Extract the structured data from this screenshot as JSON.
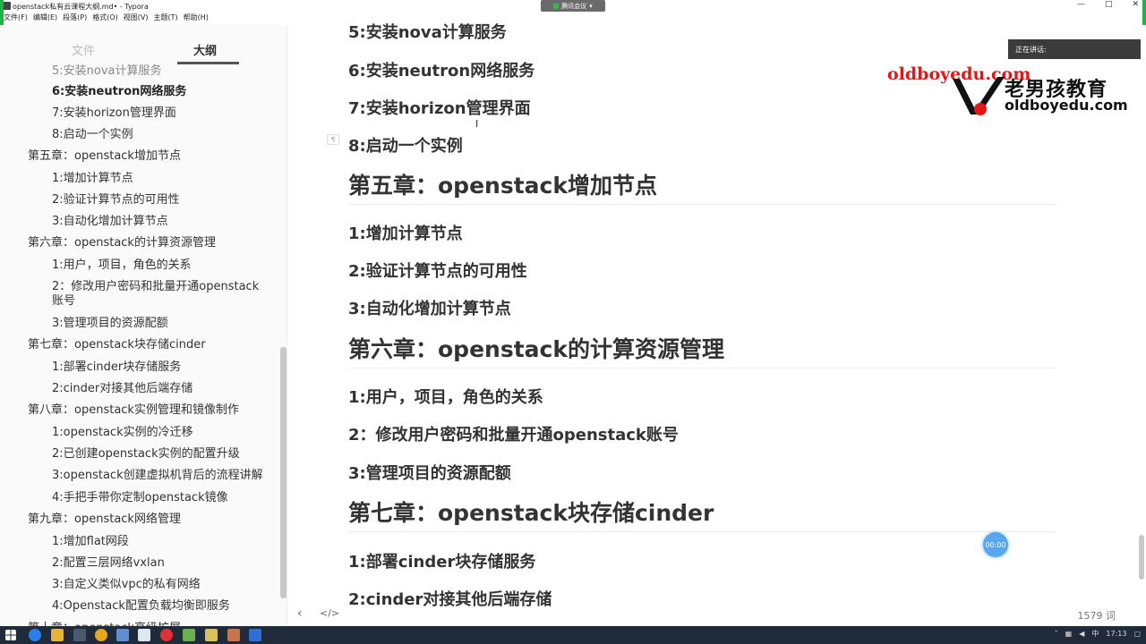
{
  "window": {
    "title": "openstack私有云课程大纲.md• - Typora",
    "min": "—",
    "max": "□",
    "close": "✕"
  },
  "meeting": {
    "label": "腾讯会议"
  },
  "menu": [
    "文件(F)",
    "编辑(E)",
    "段落(P)",
    "格式(O)",
    "视图(V)",
    "主题(T)",
    "帮助(H)"
  ],
  "sidebar": {
    "tab_files": "文件",
    "tab_outline": "大纲",
    "outline": [
      {
        "text": "5:安装nova计算服务",
        "level": 2
      },
      {
        "text": "6:安装neutron网络服务",
        "level": 2,
        "current": true
      },
      {
        "text": "7:安装horizon管理界面",
        "level": 2
      },
      {
        "text": "8:启动一个实例",
        "level": 2
      },
      {
        "text": "第五章：openstack增加节点",
        "level": 1
      },
      {
        "text": "1:增加计算节点",
        "level": 2
      },
      {
        "text": "2:验证计算节点的可用性",
        "level": 2
      },
      {
        "text": "3:自动化增加计算节点",
        "level": 2
      },
      {
        "text": "第六章：openstack的计算资源管理",
        "level": 1
      },
      {
        "text": "1:用户，项目，角色的关系",
        "level": 2
      },
      {
        "text": "2：修改用户密码和批量开通openstack账号",
        "level": 2,
        "wrap": true
      },
      {
        "text": "3:管理项目的资源配额",
        "level": 2
      },
      {
        "text": "第七章：openstack块存储cinder",
        "level": 1
      },
      {
        "text": "1:部署cinder块存储服务",
        "level": 2
      },
      {
        "text": "2:cinder对接其他后端存储",
        "level": 2
      },
      {
        "text": "第八章：openstack实例管理和镜像制作",
        "level": 1
      },
      {
        "text": "1:openstack实例的冷迁移",
        "level": 2
      },
      {
        "text": "2:已创建openstack实例的配置升级",
        "level": 2
      },
      {
        "text": "3:openstack创建虚拟机背后的流程讲解",
        "level": 2
      },
      {
        "text": "4:手把手带你定制openstack镜像",
        "level": 2
      },
      {
        "text": "第九章：openstack网络管理",
        "level": 1
      },
      {
        "text": "1:增加flat网段",
        "level": 2
      },
      {
        "text": "2:配置三层网络vxlan",
        "level": 2
      },
      {
        "text": "3:自定义类似vpc的私有网络",
        "level": 2
      },
      {
        "text": "4:Openstack配置负载均衡即服务",
        "level": 2
      },
      {
        "text": "第十章：openstack高级扩展",
        "level": 1
      }
    ]
  },
  "document": {
    "h_nova": "5:安装nova计算服务",
    "h_neutron": "6:安装neutron网络服务",
    "h_horizon": "7:安装horizon管理界面",
    "h_instance": "8:启动一个实例",
    "ch5": "第五章：openstack增加节点",
    "ch5_1": "1:增加计算节点",
    "ch5_2": "2:验证计算节点的可用性",
    "ch5_3": "3:自动化增加计算节点",
    "ch6": "第六章：openstack的计算资源管理",
    "ch6_1": "1:用户，项目，角色的关系",
    "ch6_2": "2：修改用户密码和批量开通openstack账号",
    "ch6_3": "3:管理项目的资源配额",
    "ch7": "第七章：openstack块存储cinder",
    "ch7_1": "1:部署cinder块存储服务",
    "ch7_2": "2:cinder对接其他后端存储"
  },
  "overlay": {
    "logo_url": "oldboyedu.com",
    "logo_cn": "老男孩教育",
    "logo_en": "oldboyedu.com",
    "speaking": "正在讲话:",
    "timer": "00:00"
  },
  "footer": {
    "word_count": "1579 词"
  },
  "taskbar": {
    "ime": "中",
    "time": "17:13"
  }
}
